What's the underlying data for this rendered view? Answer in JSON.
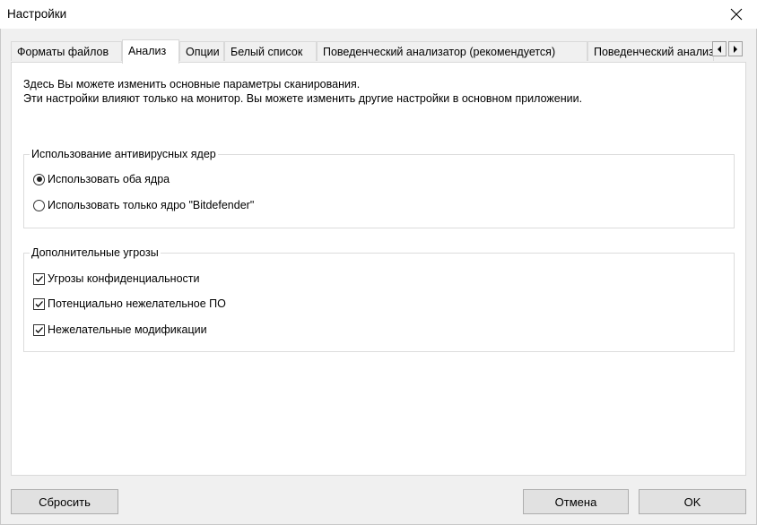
{
  "window": {
    "title": "Настройки"
  },
  "tabs": [
    {
      "label": "Форматы файлов",
      "active": false
    },
    {
      "label": "Анализ",
      "active": true
    },
    {
      "label": "Опции",
      "active": false
    },
    {
      "label": "Белый список",
      "active": false
    },
    {
      "label": "Поведенческий анализатор (рекомендуется)",
      "active": false
    },
    {
      "label": "Поведенческий анализатор",
      "active": false
    }
  ],
  "description": {
    "line1": "Здесь Вы можете изменить основные параметры сканирования.",
    "line2": "Эти настройки влияют только на монитор. Вы можете изменить другие настройки в основном приложении."
  },
  "engines_group": {
    "label": "Использование антивирусных ядер",
    "options": [
      {
        "label": "Использовать оба ядра",
        "checked": true
      },
      {
        "label": "Использовать только ядро \"Bitdefender\"",
        "checked": false
      }
    ]
  },
  "threats_group": {
    "label": "Дополнительные угрозы",
    "options": [
      {
        "label": "Угрозы конфиденциальности",
        "checked": true
      },
      {
        "label": "Потенциально нежелательное ПО",
        "checked": true
      },
      {
        "label": "Нежелательные модификации",
        "checked": true
      }
    ]
  },
  "buttons": {
    "reset": "Сбросить",
    "cancel": "Отмена",
    "ok": "OK"
  }
}
